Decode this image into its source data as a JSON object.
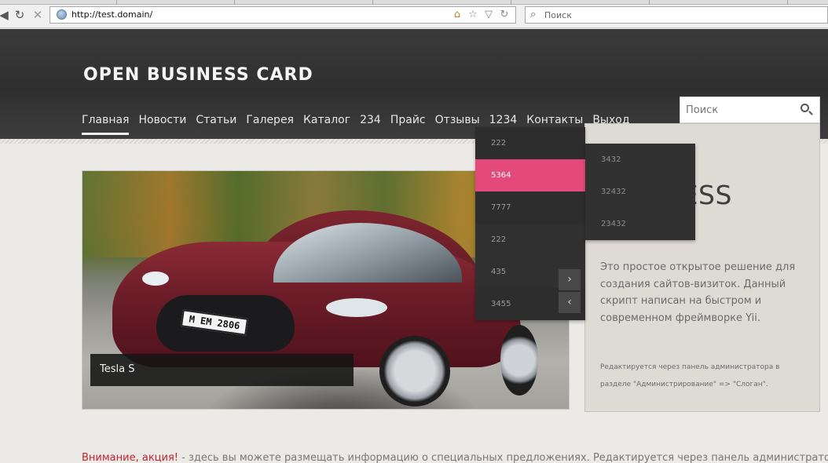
{
  "browser": {
    "url": "http://test.domain/",
    "search_placeholder": "Поиск",
    "icons": [
      "back-icon",
      "reload-icon",
      "stop-icon",
      "globe-icon",
      "home-icon",
      "star-icon",
      "dropdown-arrow-icon",
      "refresh-icon",
      "search-icon"
    ]
  },
  "site": {
    "brand": "OPEN BUSINESS CARD",
    "menu": [
      {
        "label": "Главная",
        "active": true
      },
      {
        "label": "Новости"
      },
      {
        "label": "Статьи"
      },
      {
        "label": "Галерея"
      },
      {
        "label": "Каталог"
      },
      {
        "label": "234"
      },
      {
        "label": "Прайс"
      },
      {
        "label": "Отзывы"
      },
      {
        "label": "1234"
      },
      {
        "label": "Контакты"
      },
      {
        "label": "Выход"
      }
    ],
    "search_placeholder": "Поиск",
    "dropdown": [
      "222",
      "5364",
      "7777",
      "222",
      "435",
      "3455"
    ],
    "submenu": [
      "3432",
      "32432",
      "23432"
    ],
    "slider": {
      "caption": "Tesla S",
      "plate": "M EM 2806",
      "arrows": [
        "›",
        "‹"
      ]
    },
    "info": {
      "title": "BUSINESS\nCMS",
      "text": "Это простое открытое решение для создания сайтов-визиток. Данный скрипт написан на быстром и современном фреймворке Yii.",
      "note": "Редактируется через панель администратора в разделе \"Администрирование\" => \"Слоган\"."
    },
    "notice": {
      "highlight": "Внимание, акция!",
      "text": " - здесь вы можете размещать информацию о специальных предложениях. Редактируется через панель администратора в"
    }
  },
  "colors": {
    "header_bg": "#333333",
    "accent_pink": "#e4497c",
    "dropdown_bg": "#2d2d2d",
    "notice_red": "#c2232f"
  }
}
